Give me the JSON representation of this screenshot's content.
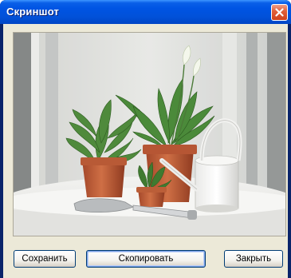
{
  "window": {
    "title": "Скриншот",
    "close_icon": "close-icon"
  },
  "picture": {
    "description_icon": "screenshot-image"
  },
  "buttons": {
    "save_label": "Сохранить",
    "copy_label": "Скопировать",
    "close_label": "Закрыть"
  },
  "colors": {
    "titlebar": "#0054e3",
    "close_button": "#d0421c",
    "client_background": "#ece9d8"
  }
}
